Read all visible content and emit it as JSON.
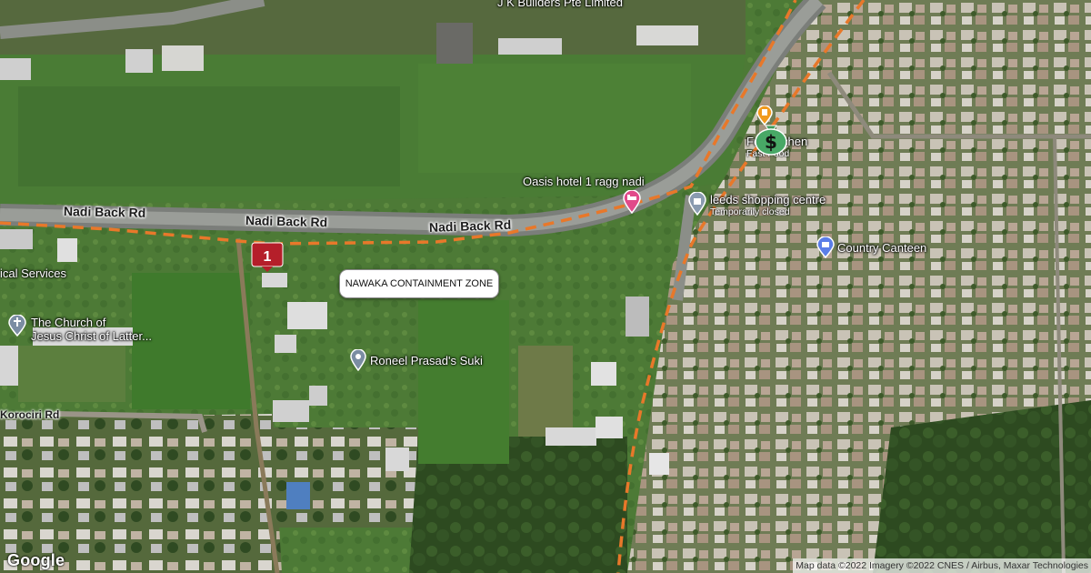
{
  "map": {
    "roads": [
      {
        "name": "Nadi Back Rd"
      },
      {
        "name": "Nadi Back Rd"
      },
      {
        "name": "Nadi Back Rd"
      },
      {
        "name": "Korocіri Rd"
      }
    ],
    "top_label": "J K Builders Pte Limited",
    "pois": {
      "oasis": "Oasis hotel 1 ragg nadi",
      "leeds": "leeds shopping centre",
      "leeds_status": "Temporarily closed",
      "canteen": "Country Canteen",
      "kitchen": "Foo kitchen",
      "kitchen_category": "Fast Food",
      "suki": "Roneel Prasad's Suki",
      "church_line1": "The Church of",
      "church_line2": "Jesus Christ of Latter...",
      "services": "ical Services"
    },
    "marker": {
      "number": "1"
    },
    "zone_label": "NAWAKA CONTAINMENT ZONE",
    "zone_boundary_color": "#e8782a",
    "brand": "Google",
    "attribution": "Map data ©2022 Imagery ©2022 CNES / Airbus, Maxar Technologies"
  }
}
